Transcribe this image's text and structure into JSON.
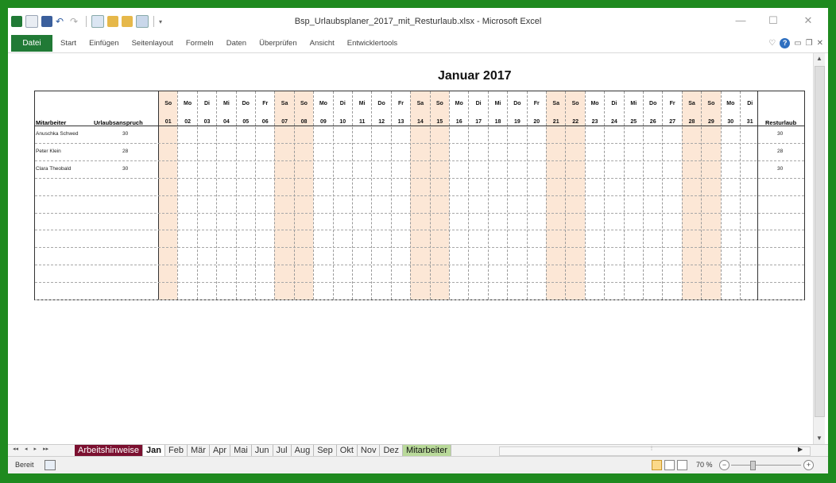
{
  "window": {
    "title": "Bsp_Urlaubsplaner_2017_mit_Resturlaub.xlsx - Microsoft Excel",
    "controls": [
      "—",
      "☐",
      "✕"
    ]
  },
  "ribbon": {
    "file_tab": "Datei",
    "tabs": [
      "Start",
      "Einfügen",
      "Seitenlayout",
      "Formeln",
      "Daten",
      "Überprüfen",
      "Ansicht",
      "Entwicklertools"
    ],
    "help_label": "?"
  },
  "sheet": {
    "month_title": "Januar 2017",
    "headers": {
      "name": "Mitarbeiter",
      "claim": "Urlaubsanspruch",
      "rest": "Resturlaub"
    },
    "weekend_color": "#fce7d6",
    "days": [
      {
        "name": "So",
        "num": "01",
        "weekend": true
      },
      {
        "name": "Mo",
        "num": "02",
        "weekend": false
      },
      {
        "name": "Di",
        "num": "03",
        "weekend": false
      },
      {
        "name": "Mi",
        "num": "04",
        "weekend": false
      },
      {
        "name": "Do",
        "num": "05",
        "weekend": false
      },
      {
        "name": "Fr",
        "num": "06",
        "weekend": false
      },
      {
        "name": "Sa",
        "num": "07",
        "weekend": true
      },
      {
        "name": "So",
        "num": "08",
        "weekend": true
      },
      {
        "name": "Mo",
        "num": "09",
        "weekend": false
      },
      {
        "name": "Di",
        "num": "10",
        "weekend": false
      },
      {
        "name": "Mi",
        "num": "11",
        "weekend": false
      },
      {
        "name": "Do",
        "num": "12",
        "weekend": false
      },
      {
        "name": "Fr",
        "num": "13",
        "weekend": false
      },
      {
        "name": "Sa",
        "num": "14",
        "weekend": true
      },
      {
        "name": "So",
        "num": "15",
        "weekend": true
      },
      {
        "name": "Mo",
        "num": "16",
        "weekend": false
      },
      {
        "name": "Di",
        "num": "17",
        "weekend": false
      },
      {
        "name": "Mi",
        "num": "18",
        "weekend": false
      },
      {
        "name": "Do",
        "num": "19",
        "weekend": false
      },
      {
        "name": "Fr",
        "num": "20",
        "weekend": false
      },
      {
        "name": "Sa",
        "num": "21",
        "weekend": true
      },
      {
        "name": "So",
        "num": "22",
        "weekend": true
      },
      {
        "name": "Mo",
        "num": "23",
        "weekend": false
      },
      {
        "name": "Di",
        "num": "24",
        "weekend": false
      },
      {
        "name": "Mi",
        "num": "25",
        "weekend": false
      },
      {
        "name": "Do",
        "num": "26",
        "weekend": false
      },
      {
        "name": "Fr",
        "num": "27",
        "weekend": false
      },
      {
        "name": "Sa",
        "num": "28",
        "weekend": true
      },
      {
        "name": "So",
        "num": "29",
        "weekend": true
      },
      {
        "name": "Mo",
        "num": "30",
        "weekend": false
      },
      {
        "name": "Di",
        "num": "31",
        "weekend": false
      }
    ],
    "employees": [
      {
        "name": "Anuschka Schwed",
        "claim": "30",
        "rest": "30"
      },
      {
        "name": "Peter Klein",
        "claim": "28",
        "rest": "28"
      },
      {
        "name": "Clara Theobald",
        "claim": "30",
        "rest": "30"
      }
    ],
    "empty_rows": 7
  },
  "sheet_tabs": {
    "tabs": [
      "Arbeitshinweise",
      "Jan",
      "Feb",
      "Mär",
      "Apr",
      "Mai",
      "Jun",
      "Jul",
      "Aug",
      "Sep",
      "Okt",
      "Nov",
      "Dez",
      "Mitarbeiter"
    ],
    "active": "Jan",
    "nav": [
      "◂◂",
      "◂",
      "▸",
      "▸▸"
    ]
  },
  "status": {
    "ready": "Bereit",
    "zoom": "70 %",
    "zoom_level_percent": 70
  }
}
